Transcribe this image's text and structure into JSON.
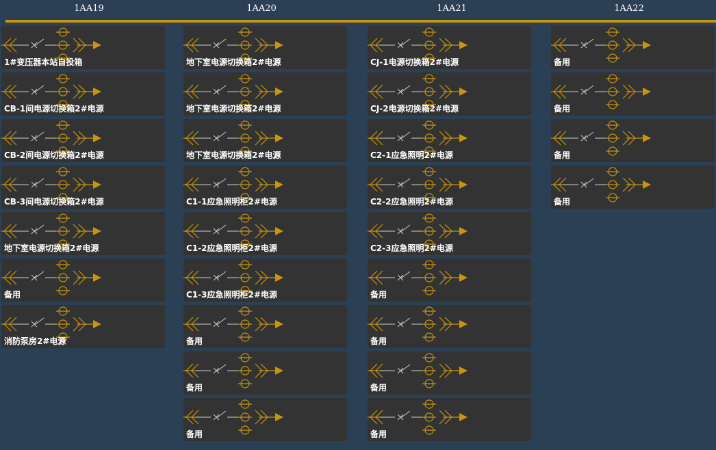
{
  "colors": {
    "background": "#2b3f55",
    "accent": "#c8950f",
    "card": "#333333",
    "switch": "#cccccc"
  },
  "icons": {
    "circuit": "circuit-breaker-diagram-icon"
  },
  "columns": [
    {
      "title": "1AA19",
      "items": [
        "1#变压器本站自投箱",
        "CB-1间电源切换箱2#电源",
        "CB-2间电源切换箱2#电源",
        "CB-3间电源切换箱2#电源",
        "地下室电源切换箱2#电源",
        "备用",
        "消防泵房2#电源"
      ]
    },
    {
      "title": "1AA20",
      "items": [
        "地下室电源切换箱2#电源",
        "地下室电源切换箱2#电源",
        "地下室电源切换箱2#电源",
        "C1-1应急照明柜2#电源",
        "C1-2应急照明柜2#电源",
        "C1-3应急照明柜2#电源",
        "备用",
        "备用",
        "备用"
      ]
    },
    {
      "title": "1AA21",
      "items": [
        "CJ-1电源切换箱2#电源",
        "CJ-2电源切换箱2#电源",
        "C2-1应急照明2#电源",
        "C2-2应急照明2#电源",
        "C2-3应急照明2#电源",
        "备用",
        "备用",
        "备用",
        "备用"
      ]
    },
    {
      "title": "1AA22",
      "items": [
        "备用",
        "备用",
        "备用",
        "备用"
      ]
    }
  ]
}
